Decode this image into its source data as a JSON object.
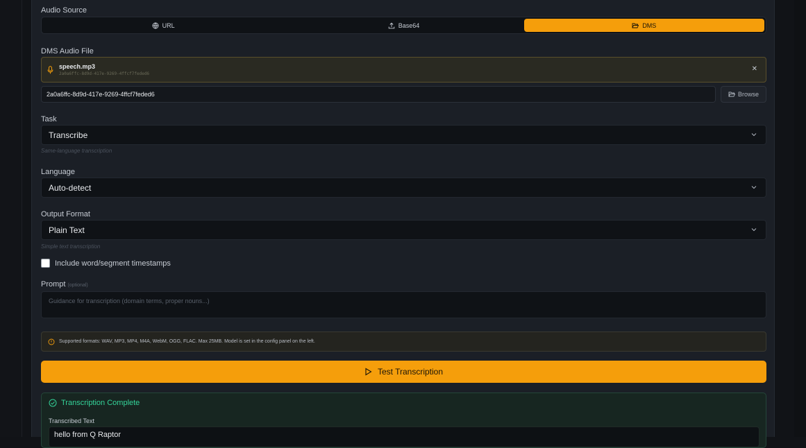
{
  "audio_source": {
    "label": "Audio Source",
    "options": [
      {
        "label": "URL",
        "icon": "globe-icon"
      },
      {
        "label": "Base64",
        "icon": "upload-icon"
      },
      {
        "label": "DMS",
        "icon": "folder-open-icon"
      }
    ],
    "selected": "DMS"
  },
  "dms": {
    "label": "DMS Audio File",
    "file_name": "speech.mp3",
    "file_id": "2a0a6ffc-8d9d-417e-9269-4ffcf7feded6",
    "input_value": "2a0a6ffc-8d9d-417e-9269-4ffcf7feded6",
    "browse_label": "Browse"
  },
  "task": {
    "label": "Task",
    "value": "Transcribe",
    "hint": "Same-language transcription"
  },
  "language": {
    "label": "Language",
    "value": "Auto-detect"
  },
  "output_format": {
    "label": "Output Format",
    "value": "Plain Text",
    "hint": "Simple text transcription"
  },
  "timestamps": {
    "label": "Include word/segment timestamps",
    "checked": false
  },
  "prompt": {
    "label": "Prompt",
    "optional": "(optional)",
    "placeholder": "Guidance for transcription (domain terms, proper nouns...)"
  },
  "info": {
    "text": "Supported formats: WAV, MP3, MP4, M4A, WebM, OGG, FLAC. Max 25MB. Model is set in the config panel on the left."
  },
  "test_button": {
    "label": "Test Transcription"
  },
  "result": {
    "title": "Transcription Complete",
    "text_label": "Transcribed Text",
    "text": "hello from Q Raptor"
  },
  "colors": {
    "accent": "#f59e0b",
    "success": "#34d399",
    "panel": "#1b1f26",
    "background": "#111317"
  }
}
